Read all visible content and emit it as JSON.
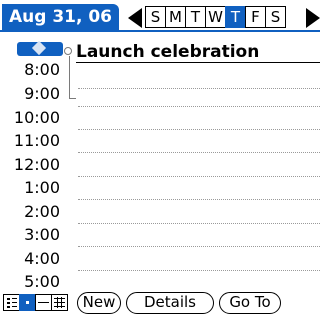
{
  "header": {
    "date_label": "Aug 31, 06",
    "weekdays": [
      "S",
      "M",
      "T",
      "W",
      "T",
      "F",
      "S"
    ],
    "selected_weekday_index": 4
  },
  "schedule": {
    "times": [
      "8:00",
      "9:00",
      "10:00",
      "11:00",
      "12:00",
      "1:00",
      "2:00",
      "3:00",
      "4:00",
      "5:00"
    ],
    "event": {
      "title": "Launch celebration",
      "start": "8:00",
      "end": "9:00"
    }
  },
  "toolbar": {
    "new_label": "New",
    "details_label": "Details",
    "goto_label": "Go To"
  },
  "colors": {
    "accent": "#1060c0"
  }
}
